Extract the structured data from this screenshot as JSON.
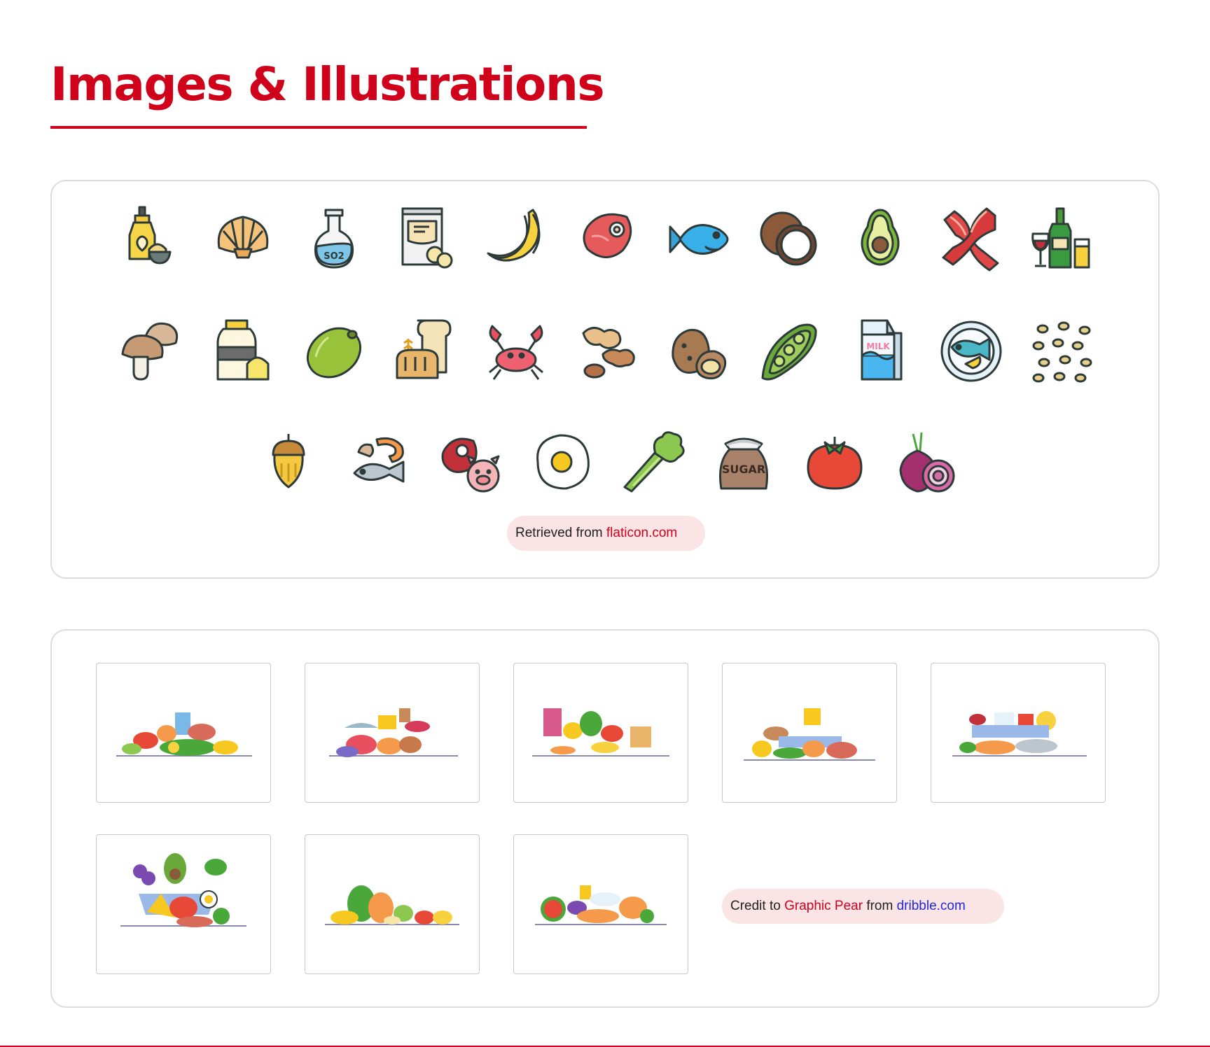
{
  "page": {
    "title": "Images & Illustrations",
    "accent_color": "#d0021b"
  },
  "icons_panel": {
    "icons": [
      "mustard-mayo-icon",
      "shell-icon",
      "sulphite-flask-icon",
      "flour-bag-icon",
      "banana-icon",
      "steak-icon",
      "fish-icon",
      "coconut-icon",
      "avocado-icon",
      "bacon-icon",
      "wine-bottle-icon",
      "mushroom-icon",
      "milk-bottle-icon",
      "olive-icon",
      "bread-icon",
      "crab-icon",
      "peanut-icon",
      "potato-icon",
      "pea-pod-icon",
      "milk-carton-icon",
      "fish-plate-icon",
      "seeds-icon",
      "acorn-icon",
      "shrimp-fish-icon",
      "pork-icon",
      "fried-egg-icon",
      "celery-icon",
      "sugar-sack-icon",
      "tomato-icon",
      "onion-icon"
    ],
    "milk_label": "MILK",
    "sugar_label": "SUGAR",
    "so2_label": "SO2",
    "credit": {
      "prefix": "Retrieved from ",
      "link": "flaticon.com"
    }
  },
  "illustrations_panel": {
    "thumbnails": [
      "food-illustration-dairy-fruit",
      "food-illustration-meat-cheese",
      "food-illustration-juice-vegetables",
      "food-illustration-pumpkin-meat",
      "food-illustration-seafood-bowl",
      "food-illustration-grocery-bag",
      "food-illustration-fruit-pile",
      "food-illustration-watermelon-veg"
    ],
    "credit": {
      "prefix": "Credit to ",
      "author": "Graphic Pear",
      "middle": " from ",
      "site": "dribble.com"
    }
  }
}
